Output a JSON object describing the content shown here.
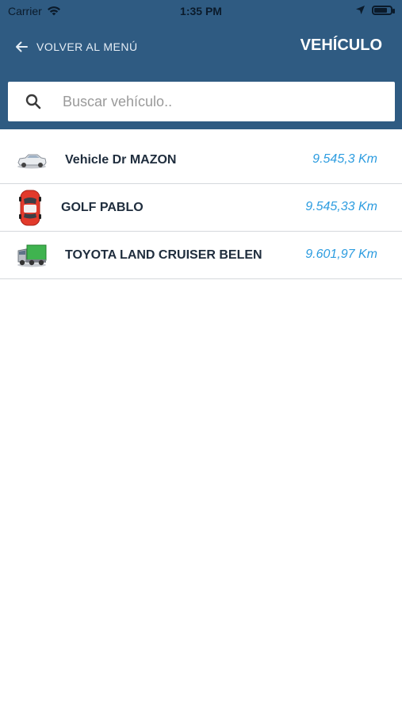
{
  "status_bar": {
    "carrier": "Carrier",
    "time": "1:35 PM"
  },
  "nav": {
    "back_label": "VOLVER AL MENÚ",
    "title": "VEHÍCULO"
  },
  "search": {
    "placeholder": "Buscar vehículo.."
  },
  "vehicles": [
    {
      "name": "Vehicle Dr MAZON",
      "distance": "9.545,3 Km",
      "icon": "sedan-car-icon"
    },
    {
      "name": "GOLF PABLO",
      "distance": "9.545,33 Km",
      "icon": "red-car-icon"
    },
    {
      "name": "TOYOTA LAND CRUISER BELEN",
      "distance": "9.601,97 Km",
      "icon": "truck-icon"
    }
  ],
  "colors": {
    "header": "#2f5b82",
    "accent": "#2e9de0"
  }
}
